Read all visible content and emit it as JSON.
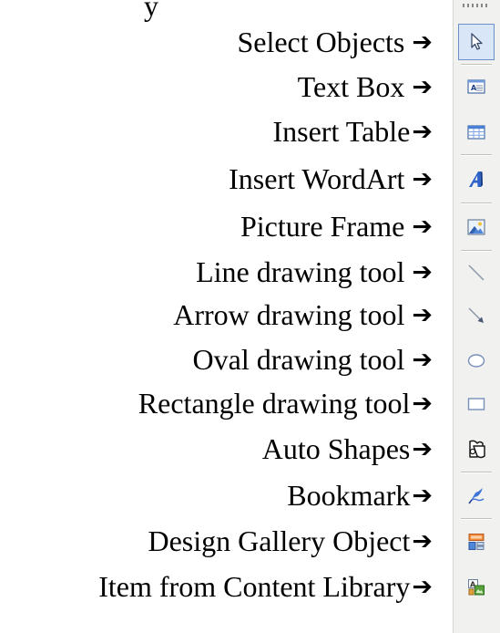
{
  "top_fragment": "y",
  "tools": [
    {
      "label": "Select Objects",
      "tight": false,
      "icon": "select-objects-icon"
    },
    {
      "label": "Text Box",
      "tight": false,
      "icon": "text-box-icon"
    },
    {
      "label": "Insert Table",
      "tight": true,
      "icon": "insert-table-icon"
    },
    {
      "label": "Insert WordArt",
      "tight": false,
      "icon": "wordart-icon"
    },
    {
      "label": "Picture Frame",
      "tight": false,
      "icon": "picture-frame-icon"
    },
    {
      "label": "Line drawing tool",
      "tight": false,
      "icon": "line-icon"
    },
    {
      "label": "Arrow drawing tool",
      "tight": false,
      "icon": "arrow-line-icon"
    },
    {
      "label": "Oval drawing tool",
      "tight": false,
      "icon": "oval-icon"
    },
    {
      "label": "Rectangle drawing tool",
      "tight": true,
      "icon": "rectangle-icon"
    },
    {
      "label": "Auto Shapes",
      "tight": true,
      "icon": "autoshapes-icon"
    },
    {
      "label": "Bookmark",
      "tight": true,
      "icon": "bookmark-icon"
    },
    {
      "label": "Design Gallery Object",
      "tight": true,
      "icon": "design-gallery-icon"
    },
    {
      "label": "Item from Content Library",
      "tight": true,
      "icon": "content-library-icon"
    }
  ],
  "arrow_glyph": "➔",
  "colors": {
    "toolbar_bg": "#f1f1ef",
    "selected_bg": "#d9e6f7",
    "selected_border": "#6c8fc8",
    "icon_blue": "#2b63c6"
  }
}
